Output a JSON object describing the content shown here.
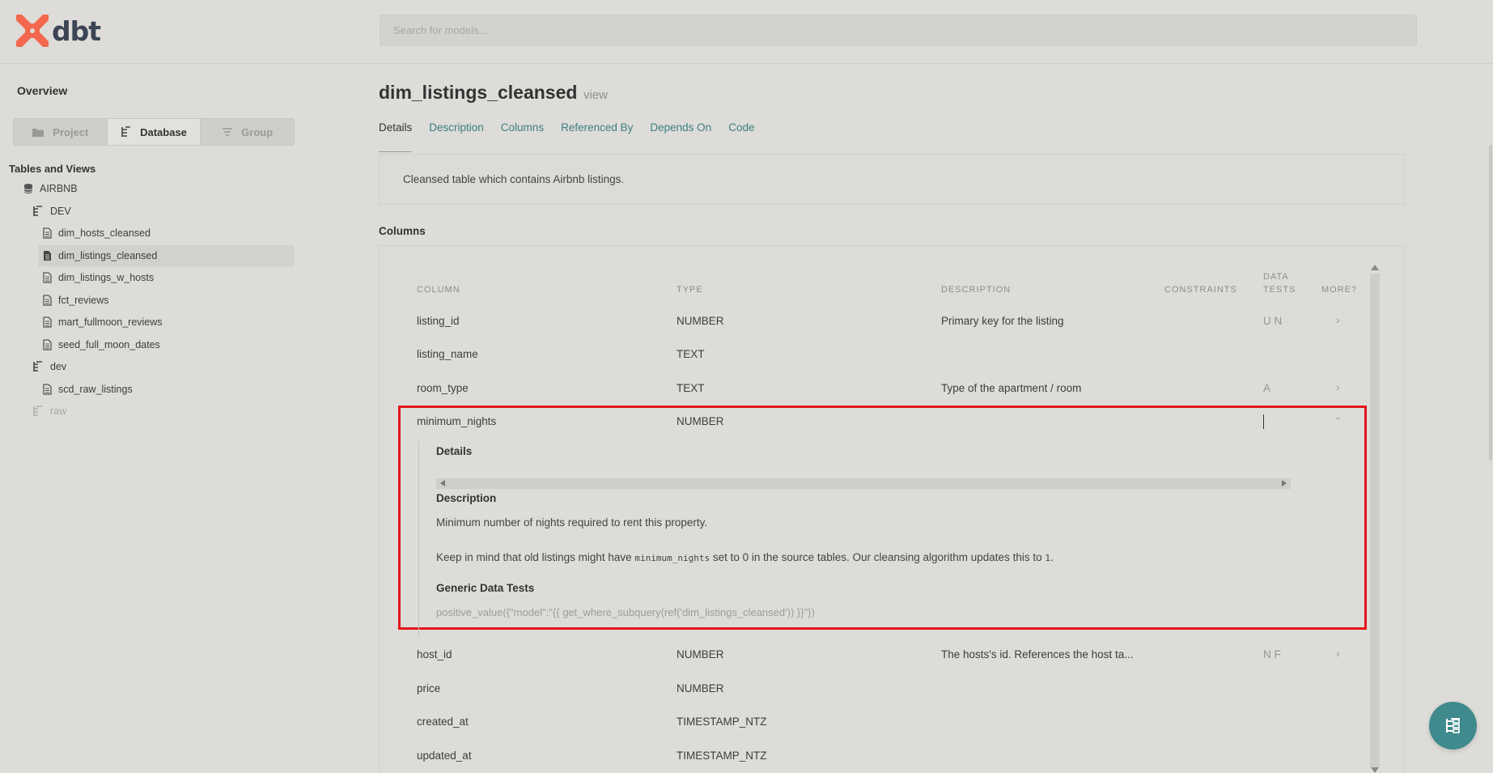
{
  "header": {
    "logo_text": "dbt",
    "search_placeholder": "Search for models..."
  },
  "sidebar": {
    "overview": "Overview",
    "segments": [
      {
        "label": "Project",
        "icon": "folder-icon",
        "active": false
      },
      {
        "label": "Database",
        "icon": "hierarchy-icon",
        "active": true
      },
      {
        "label": "Group",
        "icon": "filter-icon",
        "active": false
      }
    ],
    "tables_and_views": "Tables and Views",
    "tree": {
      "database": "AIRBNB",
      "schema_dev": "DEV",
      "dev_models": [
        "dim_hosts_cleansed",
        "dim_listings_cleansed",
        "dim_listings_w_hosts",
        "fct_reviews",
        "mart_fullmoon_reviews",
        "seed_full_moon_dates"
      ],
      "selected": "dim_listings_cleansed",
      "schema_dev_lower": "dev",
      "dev_lower_models": [
        "scd_raw_listings"
      ],
      "schema_raw": "raw"
    }
  },
  "main": {
    "title": "dim_listings_cleansed",
    "type": "view",
    "tabs": [
      "Details",
      "Description",
      "Columns",
      "Referenced By",
      "Depends On",
      "Code"
    ],
    "active_tab": "Details",
    "description": "Cleansed table which contains Airbnb listings.",
    "columns_heading": "Columns",
    "table_headers": {
      "column": "COLUMN",
      "type": "TYPE",
      "description": "DESCRIPTION",
      "constraints": "CONSTRAINTS",
      "data_tests_1": "DATA",
      "data_tests_2": "TESTS",
      "more": "MORE?"
    },
    "rows": [
      {
        "name": "listing_id",
        "type": "NUMBER",
        "description": "Primary key for the listing",
        "tests": "U N",
        "more": "›"
      },
      {
        "name": "listing_name",
        "type": "TEXT",
        "description": "",
        "tests": "",
        "more": ""
      },
      {
        "name": "room_type",
        "type": "TEXT",
        "description": "Type of the apartment / room",
        "tests": "A",
        "more": "›"
      },
      {
        "name": "minimum_nights",
        "type": "NUMBER",
        "description": "",
        "tests": "",
        "more": "ˆ"
      },
      {
        "name": "host_id",
        "type": "NUMBER",
        "description": "The hosts's id. References the host ta...",
        "tests": "N F",
        "more": "›"
      },
      {
        "name": "price",
        "type": "NUMBER",
        "description": "",
        "tests": "",
        "more": ""
      },
      {
        "name": "created_at",
        "type": "TIMESTAMP_NTZ",
        "description": "",
        "tests": "",
        "more": ""
      },
      {
        "name": "updated_at",
        "type": "TIMESTAMP_NTZ",
        "description": "",
        "tests": "",
        "more": ""
      }
    ],
    "expanded": {
      "details_heading": "Details",
      "description_heading": "Description",
      "desc_line1": "Minimum number of nights required to rent this property.",
      "desc_line2_a": "Keep in mind that old listings might have ",
      "desc_line2_code": "minimum_nights",
      "desc_line2_b": " set to 0 in the source tables. Our cleansing algorithm updates this to ",
      "desc_line2_code2": "1",
      "desc_line2_c": ".",
      "generic_tests_heading": "Generic Data Tests",
      "generic_test": "positive_value({\"model\":\"{{ get_where_subquery(ref('dim_listings_cleansed')) }}\"})"
    }
  },
  "colors": {
    "accent": "#3d7e84",
    "highlight_border": "#e3161a",
    "logo": "#f3684e",
    "fab": "#3f8a8c"
  }
}
